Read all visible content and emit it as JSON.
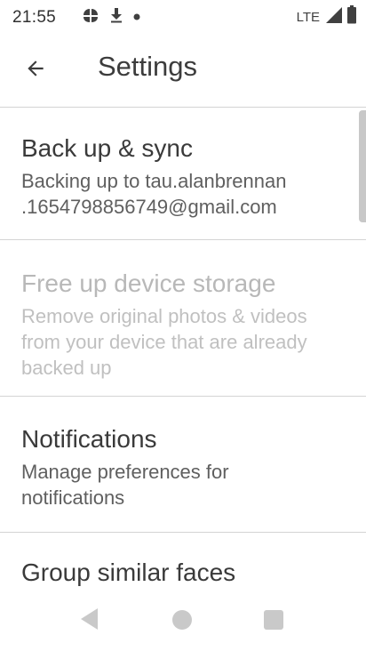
{
  "status_bar": {
    "time": "21:55",
    "network": "LTE",
    "left_icons": [
      "photos-notification-icon",
      "download-icon",
      "dot-icon"
    ],
    "right_icons": [
      "signal-icon",
      "battery-icon"
    ]
  },
  "app_bar": {
    "title": "Settings",
    "back_icon": "arrow-back-icon"
  },
  "settings": [
    {
      "title": "Back up & sync",
      "subtitle_lines": [
        "Backing up to tau.alanbrennan",
        ".1654798856749@gmail.com"
      ],
      "enabled": true
    },
    {
      "title": "Free up device storage",
      "subtitle_lines": [
        "Remove original photos & videos",
        "from your device that are already",
        "backed up"
      ],
      "enabled": false
    },
    {
      "title": "Notifications",
      "subtitle_lines": [
        "Manage preferences for",
        "notifications"
      ],
      "enabled": true
    },
    {
      "title": "Group similar faces",
      "subtitle_lines": [],
      "enabled": true
    }
  ],
  "nav_bar": {
    "icons": [
      "nav-back-icon",
      "nav-home-icon",
      "nav-recents-icon"
    ]
  },
  "colors": {
    "background": "#ffffff",
    "text_primary": "#3a3a3a",
    "text_secondary": "#5f5f5f",
    "text_disabled": "#b8b8b8",
    "divider": "#d4d4d4",
    "nav_icon": "#c9c9c9"
  }
}
